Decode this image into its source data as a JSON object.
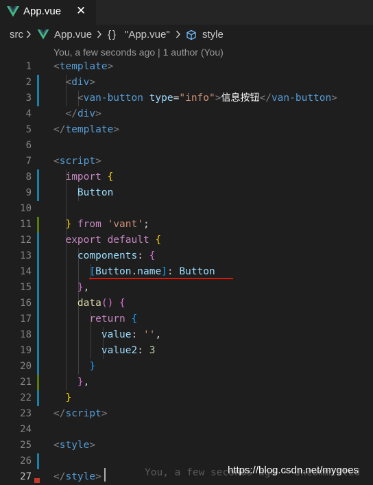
{
  "tab": {
    "label": "App.vue",
    "close": "✕"
  },
  "breadcrumb": {
    "src": "src",
    "file": "App.vue",
    "braces": "{}",
    "component": "\"App.vue\"",
    "section": "style"
  },
  "blame": "You, a few seconds ago | 1 author (You)",
  "code": {
    "lines": [
      "1",
      "2",
      "3",
      "4",
      "5",
      "6",
      "7",
      "8",
      "9",
      "10",
      "11",
      "12",
      "13",
      "14",
      "15",
      "16",
      "17",
      "18",
      "19",
      "20",
      "21",
      "22",
      "23",
      "24",
      "25",
      "26",
      "27"
    ],
    "l1": {
      "open": "<",
      "tag": "template",
      "close": ">"
    },
    "l2": {
      "open": "<",
      "tag": "div",
      "close": ">"
    },
    "l3": {
      "open": "<",
      "tag": "van-button",
      "attr": "type",
      "eq": "=",
      "val": "\"info\"",
      "gt": ">",
      "text": "信息按钮",
      "lt": "</",
      "tag2": "van-button",
      "gt2": ">"
    },
    "l4": {
      "open": "</",
      "tag": "div",
      "close": ">"
    },
    "l5": {
      "open": "</",
      "tag": "template",
      "close": ">"
    },
    "l7": {
      "open": "<",
      "tag": "script",
      "close": ">"
    },
    "l8": {
      "kw": "import",
      "brace": "{"
    },
    "l9": {
      "name": "Button"
    },
    "l11": {
      "brace": "}",
      "kw": "from",
      "str": "'vant'",
      "semi": ";"
    },
    "l12": {
      "kw": "export default",
      "brace": "{"
    },
    "l13": {
      "key": "components",
      "colon": ":",
      "brace": "{"
    },
    "l14": {
      "lb": "[",
      "obj": "Button",
      "dot": ".",
      "prop": "name",
      "rb": "]",
      "colon": ":",
      "val": "Button"
    },
    "l15": {
      "brace": "}",
      "comma": ","
    },
    "l16": {
      "fn": "data",
      "parens": "()",
      "brace": "{"
    },
    "l17": {
      "kw": "return",
      "brace": "{"
    },
    "l18": {
      "key": "value",
      "colon": ":",
      "str": "''",
      "comma": ","
    },
    "l19": {
      "key": "value2",
      "colon": ":",
      "num": "3"
    },
    "l20": {
      "brace": "}"
    },
    "l21": {
      "brace": "}",
      "comma": ","
    },
    "l22": {
      "brace": "}"
    },
    "l23": {
      "open": "</",
      "tag": "script",
      "close": ">"
    },
    "l25": {
      "open": "<",
      "tag": "style",
      "close": ">"
    },
    "l27": {
      "open": "</",
      "tag": "style",
      "close": ">"
    }
  },
  "ghost_blame": "You, a few seconds ago • Uncommitted",
  "watermark": "https://blog.csdn.net/mygoes",
  "colors": {
    "vue_green": "#41b883",
    "modified_gutter": "#1b81a8",
    "added_gutter": "#587c0c",
    "error_underline": "#e51400"
  }
}
